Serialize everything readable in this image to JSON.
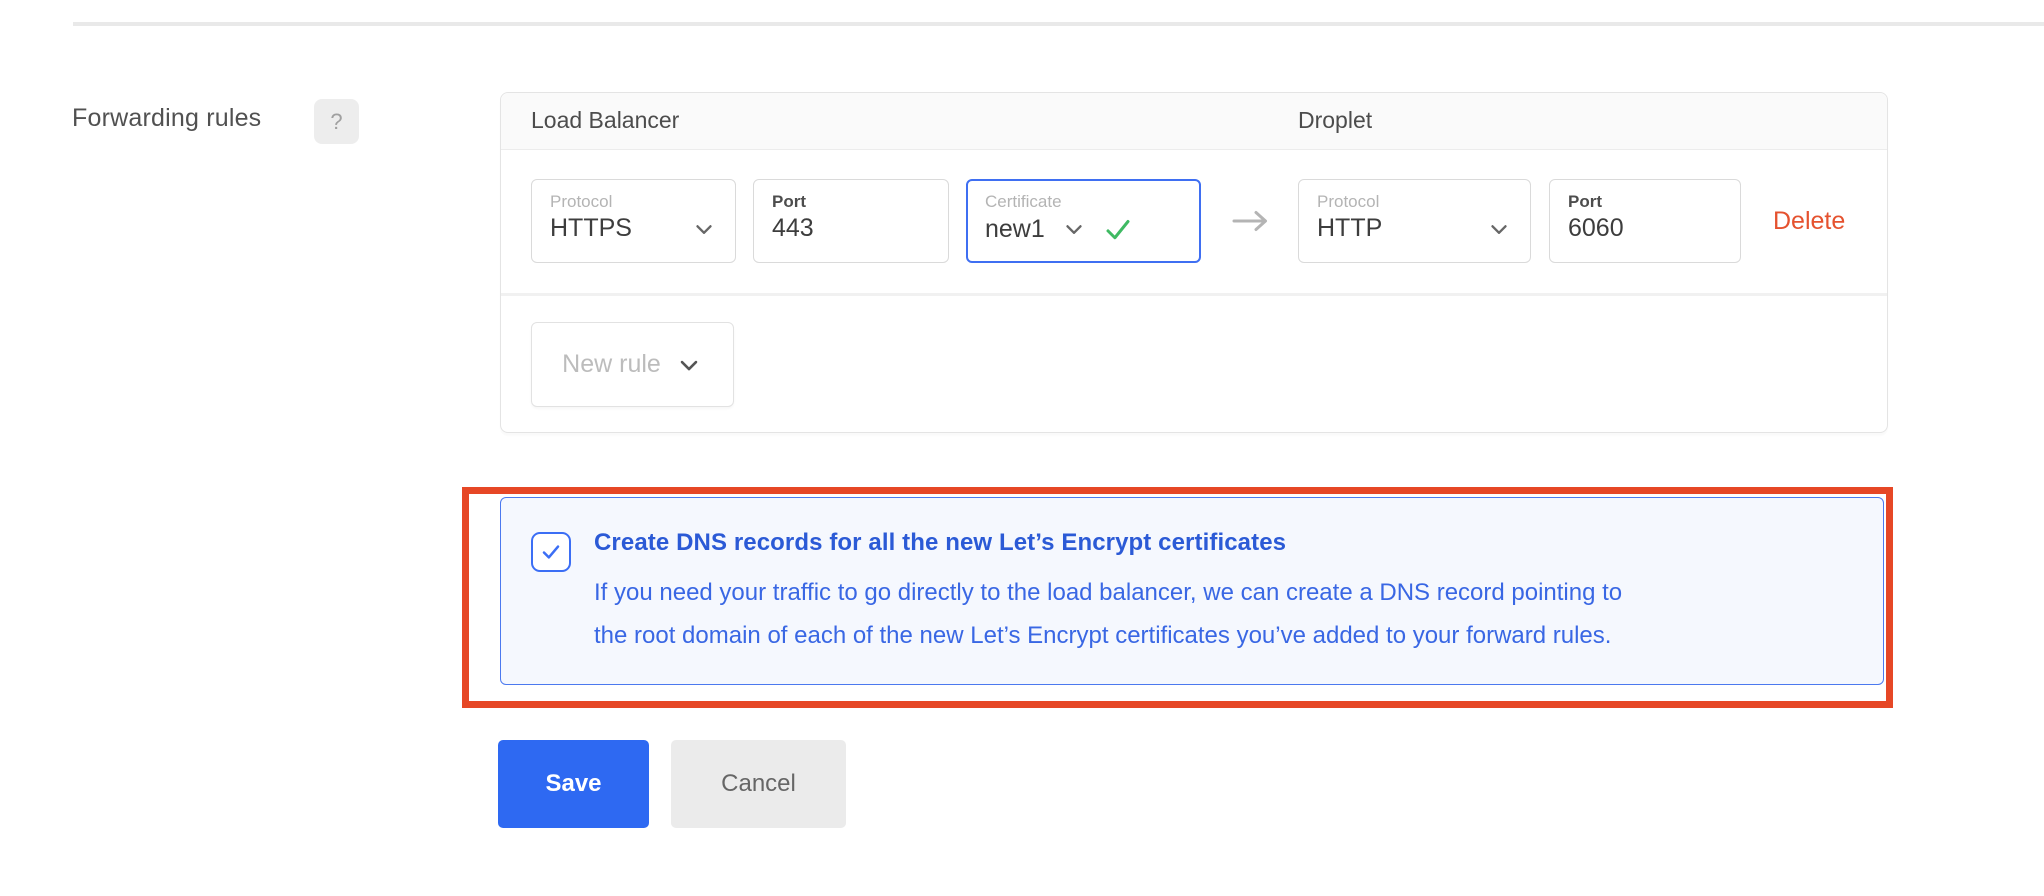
{
  "page": {
    "section_label": "Forwarding rules",
    "help_badge": "?"
  },
  "card": {
    "lb_header": "Load Balancer",
    "droplet_header": "Droplet",
    "rule": {
      "lb_protocol": {
        "label": "Protocol",
        "value": "HTTPS"
      },
      "lb_port": {
        "label": "Port",
        "value": "443"
      },
      "certificate": {
        "label": "Certificate",
        "value": "new1",
        "valid": true
      },
      "droplet_protocol": {
        "label": "Protocol",
        "value": "HTTP"
      },
      "droplet_port": {
        "label": "Port",
        "value": "6060"
      },
      "delete_label": "Delete"
    },
    "new_rule_label": "New rule"
  },
  "dns_banner": {
    "checked": true,
    "title": "Create DNS records for all the new Let’s Encrypt certificates",
    "description_lines": [
      "If you need your traffic to go directly to the load balancer, we can create a DNS record pointing to",
      "the root domain of each of the new Let’s Encrypt certificates you’ve added to your forward rules."
    ]
  },
  "actions": {
    "save": "Save",
    "cancel": "Cancel"
  },
  "icons": {
    "chevron": "chevron-down-icon",
    "check_green": "certificate-valid-check-icon",
    "check_blue": "checkbox-check-icon",
    "arrow": "forward-arrow-icon"
  },
  "colors": {
    "accent_blue": "#2e69f2",
    "banner_text_blue": "#3967e4",
    "banner_bg": "#f5f8fe",
    "banner_border": "#4b79ef",
    "highlight_red": "#e64726",
    "delete_red": "#e5522f",
    "success_green": "#3fba63"
  }
}
